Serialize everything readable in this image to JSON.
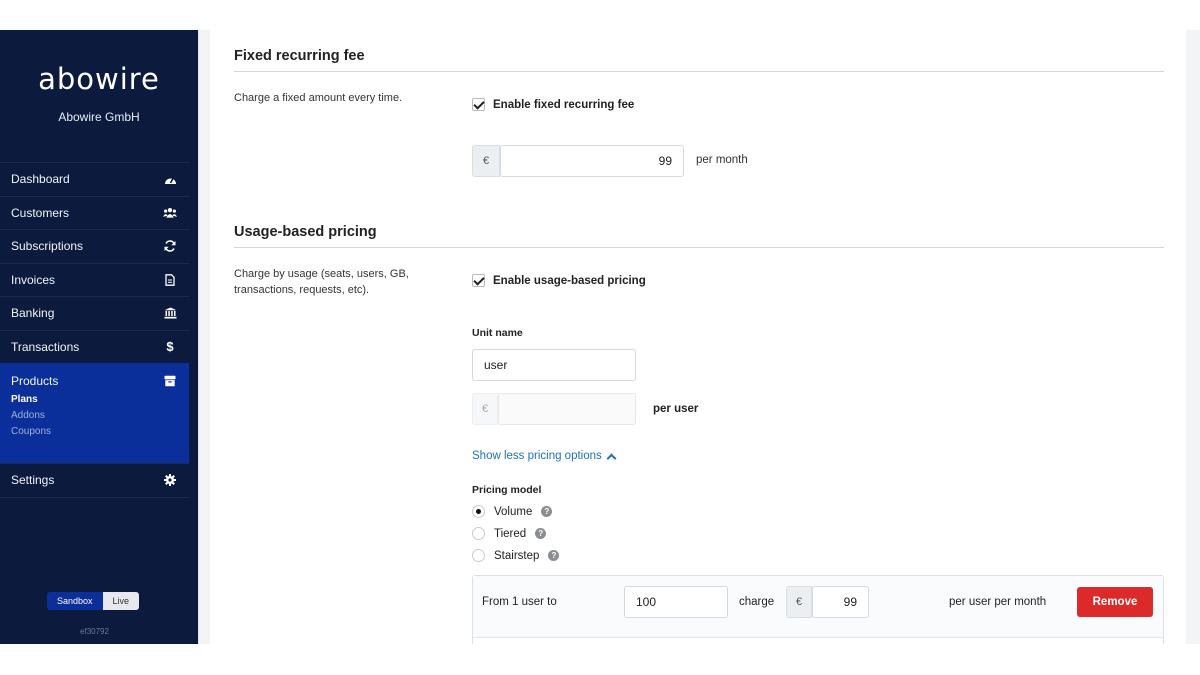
{
  "sidebar": {
    "logo": "abowire",
    "company": "Abowire GmbH",
    "items": [
      {
        "label": "Dashboard",
        "icon": "gauge-icon"
      },
      {
        "label": "Customers",
        "icon": "users-icon"
      },
      {
        "label": "Subscriptions",
        "icon": "refresh-icon"
      },
      {
        "label": "Invoices",
        "icon": "document-icon"
      },
      {
        "label": "Banking",
        "icon": "bank-icon"
      },
      {
        "label": "Transactions",
        "icon": "dollar-icon"
      }
    ],
    "products": {
      "label": "Products",
      "icon": "box-icon",
      "sub": [
        "Plans",
        "Addons",
        "Coupons"
      ],
      "current": "Plans"
    },
    "settings": {
      "label": "Settings",
      "icon": "gear-icon"
    },
    "env": {
      "sandbox": "Sandbox",
      "live": "Live",
      "selected": "Sandbox"
    },
    "build_id": "ef30792"
  },
  "fixed_fee": {
    "title": "Fixed recurring fee",
    "description": "Charge a fixed amount every time.",
    "enable_label": "Enable fixed recurring fee",
    "enabled": true,
    "currency": "€",
    "amount": "99",
    "suffix": "per month"
  },
  "usage": {
    "title": "Usage-based pricing",
    "description": "Charge by usage (seats, users, GB, transactions, requests, etc).",
    "enable_label": "Enable usage-based pricing",
    "enabled": true,
    "unit_name_label": "Unit name",
    "unit_name_value": "user",
    "unit_currency": "€",
    "unit_price_value": "",
    "unit_suffix": "per user",
    "toggle_options_label": "Show less pricing options",
    "pricing_model_label": "Pricing model",
    "models": [
      {
        "label": "Volume",
        "selected": true
      },
      {
        "label": "Tiered",
        "selected": false
      },
      {
        "label": "Stairstep",
        "selected": false
      }
    ],
    "tier": {
      "from_label": "From 1 user to",
      "to_value": "100",
      "charge_label": "charge",
      "currency": "€",
      "price_value": "99",
      "suffix": "per user per month",
      "remove_label": "Remove"
    }
  },
  "colors": {
    "sidebar_bg": "#0b1a3d",
    "sidebar_active": "#0b2f9a",
    "link": "#1f6fbf",
    "danger": "#dc2a2a"
  }
}
